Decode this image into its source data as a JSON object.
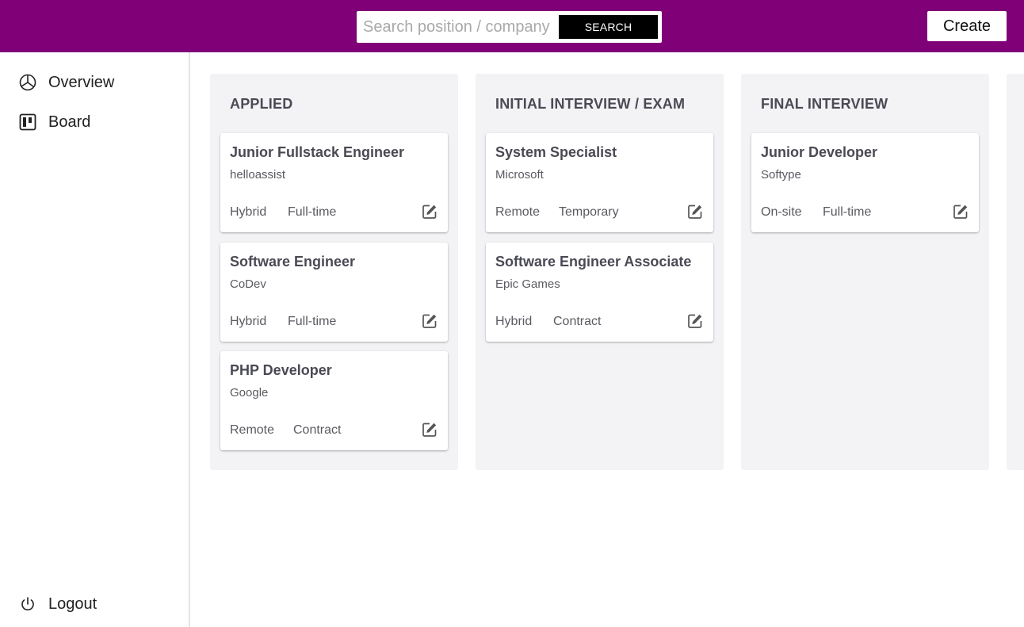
{
  "header": {
    "search_placeholder": "Search position / company",
    "search_button": "SEARCH",
    "create_button": "Create",
    "bg_color": "#800077"
  },
  "sidebar": {
    "items": [
      {
        "label": "Overview",
        "icon": "pie-chart-icon"
      },
      {
        "label": "Board",
        "icon": "kanban-board-icon"
      }
    ],
    "logout": {
      "label": "Logout",
      "icon": "power-icon"
    }
  },
  "board": {
    "columns": [
      {
        "title": "APPLIED",
        "cards": [
          {
            "title": "Junior Fullstack Engineer",
            "company": "helloassist",
            "setup": "Hybrid",
            "type": "Full-time"
          },
          {
            "title": "Software Engineer",
            "company": "CoDev",
            "setup": "Hybrid",
            "type": "Full-time"
          },
          {
            "title": "PHP Developer",
            "company": "Google",
            "setup": "Remote",
            "type": "Contract"
          }
        ]
      },
      {
        "title": "INITIAL INTERVIEW / EXAM",
        "cards": [
          {
            "title": "System Specialist",
            "company": "Microsoft",
            "setup": "Remote",
            "type": "Temporary"
          },
          {
            "title": "Software Engineer Associate",
            "company": "Epic Games",
            "setup": "Hybrid",
            "type": "Contract"
          }
        ]
      },
      {
        "title": "FINAL INTERVIEW",
        "cards": [
          {
            "title": "Junior Developer",
            "company": "Softype",
            "setup": "On-site",
            "type": "Full-time"
          }
        ]
      }
    ]
  }
}
